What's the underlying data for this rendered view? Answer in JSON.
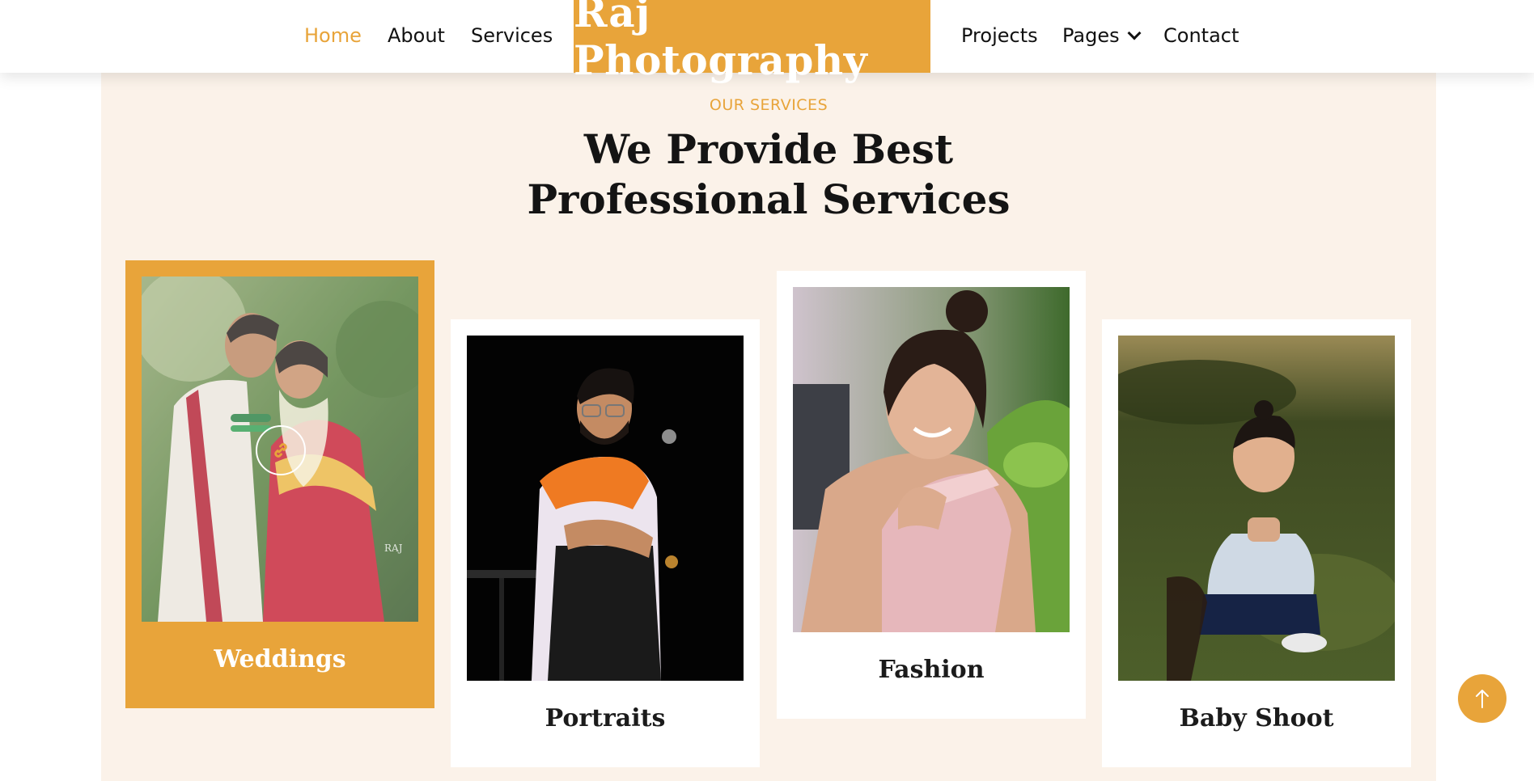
{
  "nav": {
    "items_left": [
      {
        "label": "Home",
        "active": true
      },
      {
        "label": "About"
      },
      {
        "label": "Services"
      }
    ],
    "brand": "Raj Photography",
    "items_right": [
      {
        "label": "Projects"
      },
      {
        "label": "Pages",
        "has_dropdown": true
      },
      {
        "label": "Contact"
      }
    ]
  },
  "services": {
    "eyebrow": "OUR SERVICES",
    "heading_line1": "We Provide Best",
    "heading_line2": "Professional Services",
    "cards": [
      {
        "title": "Weddings",
        "active": true,
        "icon": "link-icon"
      },
      {
        "title": "Portraits"
      },
      {
        "title": "Fashion"
      },
      {
        "title": "Baby Shoot"
      }
    ]
  },
  "scroll_top": {
    "icon": "arrow-up-icon"
  },
  "colors": {
    "accent": "#e8a43a",
    "section_bg": "#fbf2e9",
    "text": "#141414"
  }
}
